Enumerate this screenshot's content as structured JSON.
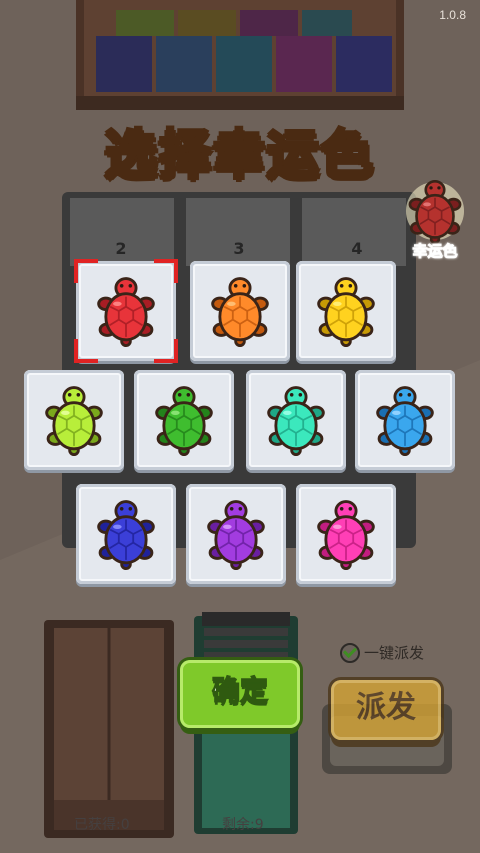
{
  "version": "1.0.8",
  "title": "选择幸运色",
  "lucky_badge": {
    "label": "幸运色",
    "color": "#b5322e"
  },
  "slot_numbers": [
    "2",
    "3",
    "4"
  ],
  "colors": [
    {
      "name": "red",
      "body": "#e8343a",
      "dark": "#a81d24",
      "light": "#ff8a8a"
    },
    {
      "name": "orange",
      "body": "#ff8a2a",
      "dark": "#c45a0e",
      "light": "#ffc27a"
    },
    {
      "name": "yellow",
      "body": "#ffd21f",
      "dark": "#c79a05",
      "light": "#fff07a"
    },
    {
      "name": "lime",
      "body": "#b8ee3a",
      "dark": "#7aa81c",
      "light": "#e6ff9a"
    },
    {
      "name": "green",
      "body": "#3fbd2f",
      "dark": "#23831b",
      "light": "#8fe67a"
    },
    {
      "name": "teal",
      "body": "#3be8bd",
      "dark": "#1ea887",
      "light": "#9bffe6"
    },
    {
      "name": "sky-blue",
      "body": "#3aa7ee",
      "dark": "#1a6fb2",
      "light": "#9ad6ff"
    },
    {
      "name": "blue",
      "body": "#3b3fd8",
      "dark": "#20229a",
      "light": "#8d90ff"
    },
    {
      "name": "purple",
      "body": "#a23ce0",
      "dark": "#6a1fa1",
      "light": "#d89aff"
    },
    {
      "name": "pink",
      "body": "#ff3fb6",
      "dark": "#c21d80",
      "light": "#ff9ddb"
    }
  ],
  "selected_color": "red",
  "confirm_label": "确定",
  "one_key_label": "一键派发",
  "dispatch_label": "派发",
  "obtained_label": "已获得:0",
  "remaining_label": "剩余:9"
}
